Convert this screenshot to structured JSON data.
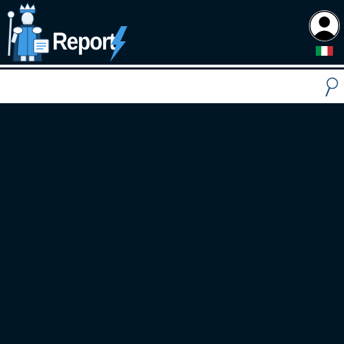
{
  "header": {
    "brand_text": "Report",
    "mascot_icon": "knight-mascot-icon",
    "bolt_icon": "lightning-bolt-icon",
    "avatar_icon": "user-avatar-icon",
    "language_flag": "italy-flag-icon"
  },
  "search": {
    "value": "",
    "icon": "search-icon"
  },
  "colors": {
    "background": "#011625",
    "bar": "#ffffff",
    "accent_blue": "#3d9be6",
    "flag": [
      "#009246",
      "#ffffff",
      "#ce2b37"
    ]
  }
}
